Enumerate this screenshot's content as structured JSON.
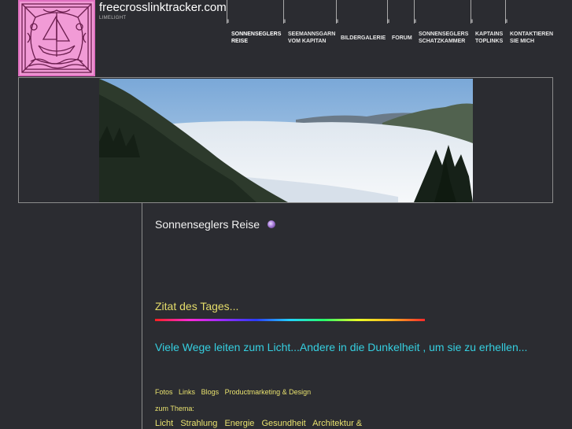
{
  "header": {
    "site_title": "freecrosslinktracker.com",
    "site_subtitle": "LIMELIGHT"
  },
  "nav": {
    "items": [
      {
        "line1": "SONNENSEGLERS",
        "line2": "REISE",
        "active": true
      },
      {
        "line1": "SEEMANNSGARN",
        "line2": "VOM KAPITAN",
        "active": false
      },
      {
        "line1": "BILDERGALERIE",
        "line2": "",
        "active": false
      },
      {
        "line1": "FORUM",
        "line2": "",
        "active": false
      },
      {
        "line1": "SONNENSEGLERS",
        "line2": "SCHATZKAMMER",
        "active": false
      },
      {
        "line1": "KAPTAINS",
        "line2": "TOPLINKS",
        "active": false
      },
      {
        "line1": "KONTAKTIEREN",
        "line2": "SIE MICH",
        "active": false
      }
    ]
  },
  "main": {
    "page_title": "Sonnenseglers Reise",
    "quote_heading": "Zitat des Tages...",
    "quote_text": "Viele Wege leiten zum Licht...Andere in die Dunkelheit , um sie zu erhellen...",
    "links": [
      "Fotos",
      "Links",
      "Blogs",
      "Productmarketing & Design"
    ],
    "thema_label": "zum Thema:",
    "themes": [
      "Licht",
      "Strahlung",
      "Energie",
      "Gesundheit",
      "Architektur &"
    ]
  },
  "colors": {
    "background": "#2b2c31",
    "logo_pink": "#f19bd6",
    "quote_cyan": "#35cfe0",
    "accent_yellow": "#e4dc6a"
  },
  "icons": {
    "title_orb": "purple-orb-icon"
  }
}
